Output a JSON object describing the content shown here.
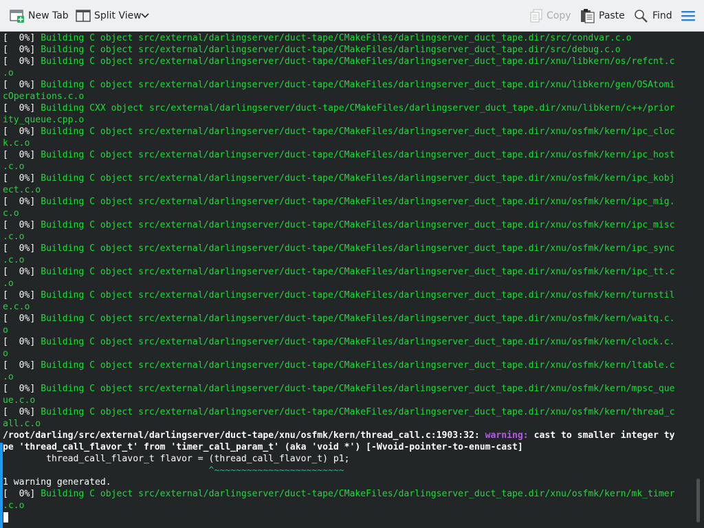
{
  "toolbar": {
    "new_tab": "New Tab",
    "split_view": "Split View",
    "copy": "Copy",
    "paste": "Paste",
    "find": "Find"
  },
  "colors": {
    "background": "#232627",
    "green_text": "#1cdc3a",
    "warning": "#b15ee0",
    "caret": "#1abc9c",
    "accent": "#1d99f3"
  },
  "terminal": {
    "lines": [
      [
        [
          "w",
          "[  0%] "
        ],
        [
          "g",
          "Building C object src/external/darlingserver/duct-tape/CMakeFiles/darlingserver_duct_tape.dir/src/condvar.c.o"
        ]
      ],
      [
        [
          "w",
          "[  0%] "
        ],
        [
          "g",
          "Building C object src/external/darlingserver/duct-tape/CMakeFiles/darlingserver_duct_tape.dir/src/debug.c.o"
        ]
      ],
      [
        [
          "w",
          "[  0%] "
        ],
        [
          "g",
          "Building C object src/external/darlingserver/duct-tape/CMakeFiles/darlingserver_duct_tape.dir/xnu/libkern/os/refcnt.c"
        ]
      ],
      [
        [
          "g",
          ".o"
        ]
      ],
      [
        [
          "w",
          "[  0%] "
        ],
        [
          "g",
          "Building C object src/external/darlingserver/duct-tape/CMakeFiles/darlingserver_duct_tape.dir/xnu/libkern/gen/OSAtomi"
        ]
      ],
      [
        [
          "g",
          "cOperations.c.o"
        ]
      ],
      [
        [
          "w",
          "[  0%] "
        ],
        [
          "g",
          "Building CXX object src/external/darlingserver/duct-tape/CMakeFiles/darlingserver_duct_tape.dir/xnu/libkern/c++/prior"
        ]
      ],
      [
        [
          "g",
          "ity_queue.cpp.o"
        ]
      ],
      [
        [
          "w",
          "[  0%] "
        ],
        [
          "g",
          "Building C object src/external/darlingserver/duct-tape/CMakeFiles/darlingserver_duct_tape.dir/xnu/osfmk/kern/ipc_cloc"
        ]
      ],
      [
        [
          "g",
          "k.c.o"
        ]
      ],
      [
        [
          "w",
          "[  0%] "
        ],
        [
          "g",
          "Building C object src/external/darlingserver/duct-tape/CMakeFiles/darlingserver_duct_tape.dir/xnu/osfmk/kern/ipc_host"
        ]
      ],
      [
        [
          "g",
          ".c.o"
        ]
      ],
      [
        [
          "w",
          "[  0%] "
        ],
        [
          "g",
          "Building C object src/external/darlingserver/duct-tape/CMakeFiles/darlingserver_duct_tape.dir/xnu/osfmk/kern/ipc_kobj"
        ]
      ],
      [
        [
          "g",
          "ect.c.o"
        ]
      ],
      [
        [
          "w",
          "[  0%] "
        ],
        [
          "g",
          "Building C object src/external/darlingserver/duct-tape/CMakeFiles/darlingserver_duct_tape.dir/xnu/osfmk/kern/ipc_mig."
        ]
      ],
      [
        [
          "g",
          "c.o"
        ]
      ],
      [
        [
          "w",
          "[  0%] "
        ],
        [
          "g",
          "Building C object src/external/darlingserver/duct-tape/CMakeFiles/darlingserver_duct_tape.dir/xnu/osfmk/kern/ipc_misc"
        ]
      ],
      [
        [
          "g",
          ".c.o"
        ]
      ],
      [
        [
          "w",
          "[  0%] "
        ],
        [
          "g",
          "Building C object src/external/darlingserver/duct-tape/CMakeFiles/darlingserver_duct_tape.dir/xnu/osfmk/kern/ipc_sync"
        ]
      ],
      [
        [
          "g",
          ".c.o"
        ]
      ],
      [
        [
          "w",
          "[  0%] "
        ],
        [
          "g",
          "Building C object src/external/darlingserver/duct-tape/CMakeFiles/darlingserver_duct_tape.dir/xnu/osfmk/kern/ipc_tt.c"
        ]
      ],
      [
        [
          "g",
          ".o"
        ]
      ],
      [
        [
          "w",
          "[  0%] "
        ],
        [
          "g",
          "Building C object src/external/darlingserver/duct-tape/CMakeFiles/darlingserver_duct_tape.dir/xnu/osfmk/kern/turnstil"
        ]
      ],
      [
        [
          "g",
          "e.c.o"
        ]
      ],
      [
        [
          "w",
          "[  0%] "
        ],
        [
          "g",
          "Building C object src/external/darlingserver/duct-tape/CMakeFiles/darlingserver_duct_tape.dir/xnu/osfmk/kern/waitq.c."
        ]
      ],
      [
        [
          "g",
          "o"
        ]
      ],
      [
        [
          "w",
          "[  0%] "
        ],
        [
          "g",
          "Building C object src/external/darlingserver/duct-tape/CMakeFiles/darlingserver_duct_tape.dir/xnu/osfmk/kern/clock.c."
        ]
      ],
      [
        [
          "g",
          "o"
        ]
      ],
      [
        [
          "w",
          "[  0%] "
        ],
        [
          "g",
          "Building C object src/external/darlingserver/duct-tape/CMakeFiles/darlingserver_duct_tape.dir/xnu/osfmk/kern/ltable.c"
        ]
      ],
      [
        [
          "g",
          ".o"
        ]
      ],
      [
        [
          "w",
          "[  0%] "
        ],
        [
          "g",
          "Building C object src/external/darlingserver/duct-tape/CMakeFiles/darlingserver_duct_tape.dir/xnu/osfmk/kern/mpsc_que"
        ]
      ],
      [
        [
          "g",
          "ue.c.o"
        ]
      ],
      [
        [
          "w",
          "[  0%] "
        ],
        [
          "g",
          "Building C object src/external/darlingserver/duct-tape/CMakeFiles/darlingserver_duct_tape.dir/xnu/osfmk/kern/thread_c"
        ]
      ],
      [
        [
          "g",
          "all.c.o"
        ]
      ],
      [
        [
          "b",
          "/root/darling/src/external/darlingserver/duct-tape/xnu/osfmk/kern/thread_call.c:1903:32: "
        ],
        [
          "m",
          "warning: "
        ],
        [
          "b",
          "cast to smaller integer ty"
        ]
      ],
      [
        [
          "b",
          "pe 'thread_call_flavor_t' from 'timer_call_param_t' (aka 'void *') [-Wvoid-pointer-to-enum-cast]"
        ]
      ],
      [
        [
          "w",
          "        thread_call_flavor_t flavor = (thread_call_flavor_t) p1;"
        ]
      ],
      [
        [
          "c",
          "                                      ^~~~~~~~~~~~~~~~~~~~~~~~~"
        ]
      ],
      [
        [
          "w",
          "1 warning generated."
        ]
      ],
      [
        [
          "w",
          "[  0%] "
        ],
        [
          "g",
          "Building C object src/external/darlingserver/duct-tape/CMakeFiles/darlingserver_duct_tape.dir/xnu/osfmk/kern/mk_timer"
        ]
      ],
      [
        [
          "g",
          ".c.o"
        ]
      ]
    ]
  }
}
